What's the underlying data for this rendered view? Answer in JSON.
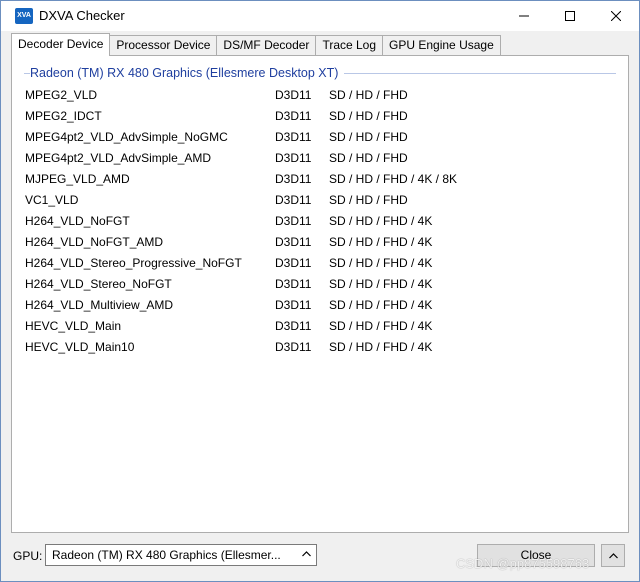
{
  "window": {
    "title": "DXVA Checker",
    "icon_text": "XVA",
    "icon": "app-icon"
  },
  "tabs": [
    {
      "label": "Decoder Device",
      "active": true
    },
    {
      "label": "Processor Device",
      "active": false
    },
    {
      "label": "DS/MF Decoder",
      "active": false
    },
    {
      "label": "Trace Log",
      "active": false
    },
    {
      "label": "GPU Engine Usage",
      "active": false
    }
  ],
  "group": {
    "title": "Radeon (TM) RX 480 Graphics (Ellesmere Desktop XT)"
  },
  "decoders": [
    {
      "name": "MPEG2_VLD",
      "api": "D3D11",
      "res": "SD / HD / FHD"
    },
    {
      "name": "MPEG2_IDCT",
      "api": "D3D11",
      "res": "SD / HD / FHD"
    },
    {
      "name": "MPEG4pt2_VLD_AdvSimple_NoGMC",
      "api": "D3D11",
      "res": "SD / HD / FHD"
    },
    {
      "name": "MPEG4pt2_VLD_AdvSimple_AMD",
      "api": "D3D11",
      "res": "SD / HD / FHD"
    },
    {
      "name": "MJPEG_VLD_AMD",
      "api": "D3D11",
      "res": "SD / HD / FHD / 4K / 8K"
    },
    {
      "name": "VC1_VLD",
      "api": "D3D11",
      "res": "SD / HD / FHD"
    },
    {
      "name": "H264_VLD_NoFGT",
      "api": "D3D11",
      "res": "SD / HD / FHD / 4K"
    },
    {
      "name": "H264_VLD_NoFGT_AMD",
      "api": "D3D11",
      "res": "SD / HD / FHD / 4K"
    },
    {
      "name": "H264_VLD_Stereo_Progressive_NoFGT",
      "api": "D3D11",
      "res": "SD / HD / FHD / 4K"
    },
    {
      "name": "H264_VLD_Stereo_NoFGT",
      "api": "D3D11",
      "res": "SD / HD / FHD / 4K"
    },
    {
      "name": "H264_VLD_Multiview_AMD",
      "api": "D3D11",
      "res": "SD / HD / FHD / 4K"
    },
    {
      "name": "HEVC_VLD_Main",
      "api": "D3D11",
      "res": "SD / HD / FHD / 4K"
    },
    {
      "name": "HEVC_VLD_Main10",
      "api": "D3D11",
      "res": "SD / HD / FHD / 4K"
    }
  ],
  "footer": {
    "gpu_label": "GPU:",
    "gpu_selected": "Radeon (TM) RX 480 Graphics (Ellesmer...",
    "close_label": "Close"
  },
  "watermark": "CSDN @pp875598763"
}
